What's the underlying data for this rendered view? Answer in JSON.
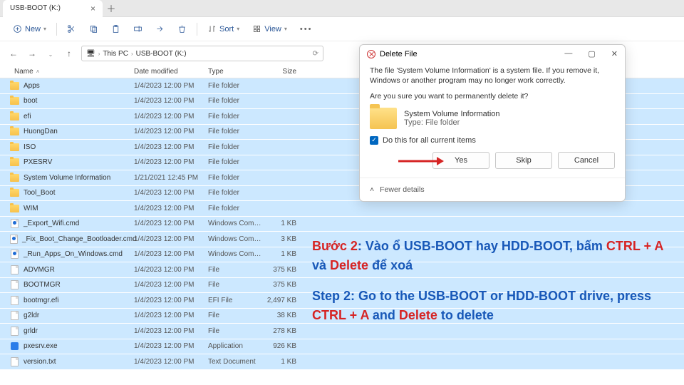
{
  "tab": {
    "title": "USB-BOOT (K:)"
  },
  "toolbar": {
    "new": "New",
    "sort": "Sort",
    "view": "View"
  },
  "breadcrumb": {
    "root": "This PC",
    "current": "USB-BOOT (K:)"
  },
  "columns": {
    "name": "Name",
    "date": "Date modified",
    "type": "Type",
    "size": "Size"
  },
  "files": [
    {
      "name": "Apps",
      "date": "1/4/2023 12:00 PM",
      "type": "File folder",
      "size": "",
      "icon": "folder"
    },
    {
      "name": "boot",
      "date": "1/4/2023 12:00 PM",
      "type": "File folder",
      "size": "",
      "icon": "folder"
    },
    {
      "name": "efi",
      "date": "1/4/2023 12:00 PM",
      "type": "File folder",
      "size": "",
      "icon": "folder"
    },
    {
      "name": "HuongDan",
      "date": "1/4/2023 12:00 PM",
      "type": "File folder",
      "size": "",
      "icon": "folder"
    },
    {
      "name": "ISO",
      "date": "1/4/2023 12:00 PM",
      "type": "File folder",
      "size": "",
      "icon": "folder"
    },
    {
      "name": "PXESRV",
      "date": "1/4/2023 12:00 PM",
      "type": "File folder",
      "size": "",
      "icon": "folder"
    },
    {
      "name": "System Volume Information",
      "date": "1/21/2021 12:45 PM",
      "type": "File folder",
      "size": "",
      "icon": "folder"
    },
    {
      "name": "Tool_Boot",
      "date": "1/4/2023 12:00 PM",
      "type": "File folder",
      "size": "",
      "icon": "folder"
    },
    {
      "name": "WIM",
      "date": "1/4/2023 12:00 PM",
      "type": "File folder",
      "size": "",
      "icon": "folder"
    },
    {
      "name": "_Export_Wifi.cmd",
      "date": "1/4/2023 12:00 PM",
      "type": "Windows Comma...",
      "size": "1 KB",
      "icon": "cmd"
    },
    {
      "name": "_Fix_Boot_Change_Bootloader.cmd",
      "date": "1/4/2023 12:00 PM",
      "type": "Windows Comma...",
      "size": "3 KB",
      "icon": "cmd"
    },
    {
      "name": "_Run_Apps_On_Windows.cmd",
      "date": "1/4/2023 12:00 PM",
      "type": "Windows Comma...",
      "size": "1 KB",
      "icon": "cmd"
    },
    {
      "name": "ADVMGR",
      "date": "1/4/2023 12:00 PM",
      "type": "File",
      "size": "375 KB",
      "icon": "file"
    },
    {
      "name": "BOOTMGR",
      "date": "1/4/2023 12:00 PM",
      "type": "File",
      "size": "375 KB",
      "icon": "file"
    },
    {
      "name": "bootmgr.efi",
      "date": "1/4/2023 12:00 PM",
      "type": "EFI File",
      "size": "2,497 KB",
      "icon": "file"
    },
    {
      "name": "g2ldr",
      "date": "1/4/2023 12:00 PM",
      "type": "File",
      "size": "38 KB",
      "icon": "file"
    },
    {
      "name": "grldr",
      "date": "1/4/2023 12:00 PM",
      "type": "File",
      "size": "278 KB",
      "icon": "file"
    },
    {
      "name": "pxesrv.exe",
      "date": "1/4/2023 12:00 PM",
      "type": "Application",
      "size": "926 KB",
      "icon": "exe"
    },
    {
      "name": "version.txt",
      "date": "1/4/2023 12:00 PM",
      "type": "Text Document",
      "size": "1 KB",
      "icon": "file"
    }
  ],
  "dialog": {
    "title": "Delete File",
    "msg1": "The file 'System Volume Information' is a system file. If you remove it, Windows or another program may no longer work correctly.",
    "msg2": "Are you sure you want to permanently delete it?",
    "item_name": "System Volume Information",
    "item_type": "Type: File folder",
    "check": "Do this for all current items",
    "yes": "Yes",
    "skip": "Skip",
    "cancel": "Cancel",
    "fewer": "Fewer details"
  },
  "instr": {
    "vn_prefix": "Bước 2",
    "vn_mid": ": Vào ổ USB-BOOT hay HDD-BOOT, bấm ",
    "vn_ctrl": "CTRL + A",
    "vn_and": " và ",
    "vn_del": "Delete",
    "vn_end": " để xoá",
    "en_prefix": "Step 2: Go to the USB-BOOT or HDD-BOOT drive, press ",
    "en_ctrl": "CTRL + A",
    "en_and": " and ",
    "en_del": "Delete",
    "en_end": " to delete"
  }
}
